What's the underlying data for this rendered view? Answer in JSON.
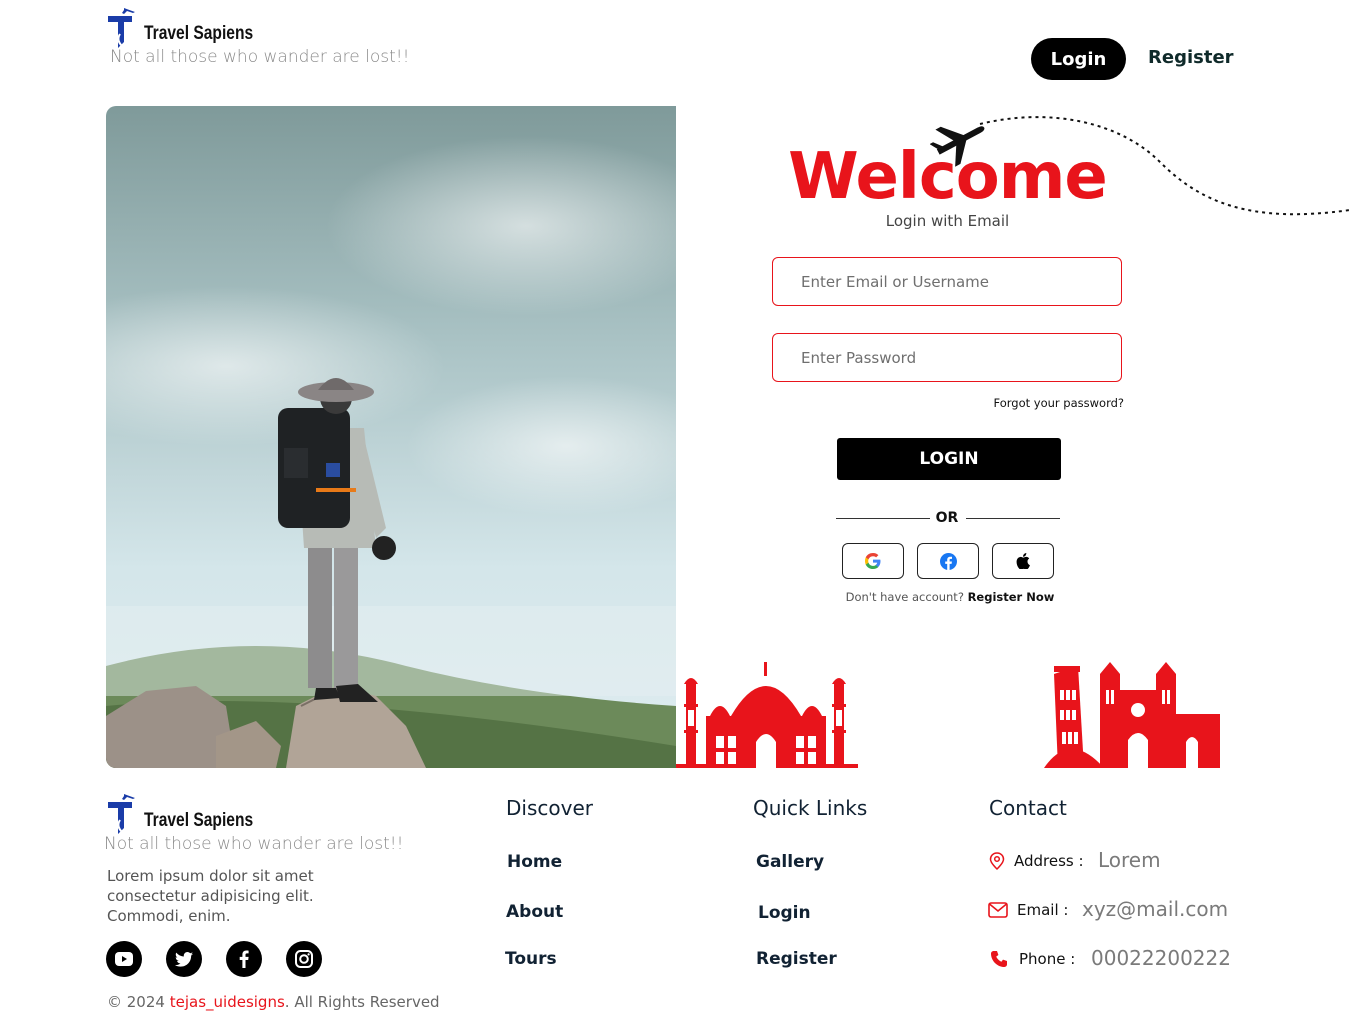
{
  "header": {
    "logo_text": "Travel Sapiens",
    "tagline": "Not all those who wander are lost!!",
    "login_label": "Login",
    "register_label": "Register"
  },
  "form": {
    "title": "Welcome",
    "subtitle": "Login with Email",
    "email_placeholder": "Enter Email or Username",
    "password_placeholder": "Enter Password",
    "forgot_label": "Forgot your password?",
    "login_button": "LOGIN",
    "or_label": "OR",
    "social_icons": [
      "google-icon",
      "facebook-icon",
      "apple-icon"
    ],
    "no_account_text": "Don't have account?",
    "register_now": "Register Now"
  },
  "footer": {
    "logo_text": "Travel Sapiens",
    "tagline": "Not all those who wander are lost!!",
    "description": "Lorem ipsum dolor sit amet consectetur adipisicing elit. Commodi, enim.",
    "social_icons": [
      "youtube-icon",
      "twitter-icon",
      "facebook-icon",
      "instagram-icon"
    ],
    "copyright_prefix": "© 2024",
    "copyright_brand": "tejas_uidesigns",
    "copyright_suffix": ". All Rights Reserved",
    "discover": {
      "title": "Discover",
      "links": [
        "Home",
        "About",
        "Tours"
      ]
    },
    "quick_links": {
      "title": "Quick Links",
      "links": [
        "Gallery",
        "Login",
        "Register"
      ]
    },
    "contact": {
      "title": "Contact",
      "address_label": "Address :",
      "address_value": "Lorem",
      "email_label": "Email :",
      "email_value": "xyz@mail.com",
      "phone_label": "Phone :",
      "phone_value": "00022200222"
    }
  },
  "colors": {
    "accent": "#e8141b",
    "dark": "#000000",
    "logo_blue": "#1a3ca8"
  }
}
